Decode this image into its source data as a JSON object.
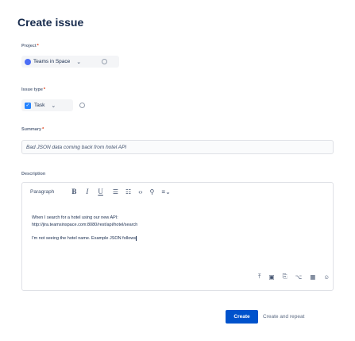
{
  "dialog": {
    "title": "Create issue"
  },
  "project": {
    "label": "Project",
    "required_mark": "*",
    "value": "Teams in Space",
    "icon": "project-avatar-icon",
    "chevron": "⌄",
    "info_icon": "info-icon"
  },
  "issue_type": {
    "label": "Issue type",
    "required_mark": "*",
    "value": "Task",
    "icon": "task-checkbox-icon",
    "chevron": "⌄",
    "info_icon": "info-icon"
  },
  "summary": {
    "label": "Summary",
    "required_mark": "*",
    "value": "Bad JSON data coming back from hotel API"
  },
  "description": {
    "label": "Description",
    "toolbar": {
      "paragraph": "Paragraph",
      "bold": "B",
      "italic": "I",
      "underline": "U",
      "bullet_list": "☰",
      "numbered_list": "☷",
      "code": "‹›",
      "link": "⚲",
      "more": "≡⌄"
    },
    "lines": [
      "When I search for a hotel using our new API:",
      "http://jira.teamsinspace.com:8080/rest/api/hotel/search",
      "I'm not seeing the hotel name. Example JSON follows"
    ],
    "attach_icons": {
      "upload": "⤒",
      "image": "▣",
      "attachment": "⎘",
      "mention": "⌥",
      "emoji": "☺"
    }
  },
  "actions": {
    "create": "Create",
    "create_and_repeat": "Create and repeat"
  },
  "colors": {
    "primary": "#0052cc",
    "required": "#de350b",
    "text": "#172b4d"
  }
}
